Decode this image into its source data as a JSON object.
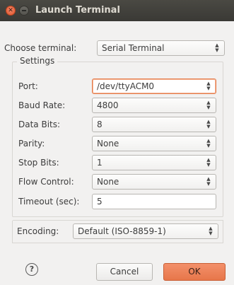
{
  "window": {
    "title": "Launch Terminal"
  },
  "terminal": {
    "label": "Choose terminal:",
    "value": "Serial Terminal"
  },
  "settings": {
    "title": "Settings",
    "port": {
      "label": "Port:",
      "value": "/dev/ttyACM0"
    },
    "baud_rate": {
      "label": "Baud Rate:",
      "value": "4800"
    },
    "data_bits": {
      "label": "Data Bits:",
      "value": "8"
    },
    "parity": {
      "label": "Parity:",
      "value": "None"
    },
    "stop_bits": {
      "label": "Stop Bits:",
      "value": "1"
    },
    "flow_control": {
      "label": "Flow Control:",
      "value": "None"
    },
    "timeout": {
      "label": "Timeout (sec):",
      "value": "5"
    }
  },
  "encoding": {
    "label": "Encoding:",
    "value": "Default (ISO-8859-1)"
  },
  "buttons": {
    "help": "?",
    "cancel": "Cancel",
    "ok": "OK"
  },
  "icons": {
    "close": "close-icon",
    "minimize": "minimize-icon",
    "help": "help-icon",
    "dropdown": "up-down-arrows-icon"
  },
  "colors": {
    "accent": "#e7764a",
    "titlebar": "#3f3e3a"
  }
}
